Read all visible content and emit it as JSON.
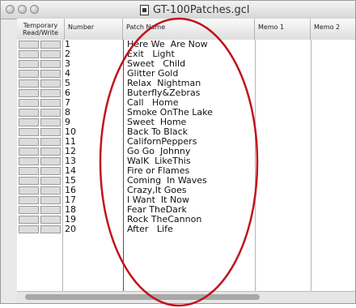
{
  "window": {
    "title": "GT-100Patches.gcl"
  },
  "columns": {
    "temporary": "Temporary",
    "read_write": "Read/Write",
    "number": "Number",
    "patch_name": "Patch Name",
    "memo1": "Memo 1",
    "memo2": "Memo 2"
  },
  "patches": [
    {
      "number": "1",
      "name": "Here We  Are Now"
    },
    {
      "number": "2",
      "name": "Exit   Light"
    },
    {
      "number": "3",
      "name": "Sweet   Child"
    },
    {
      "number": "4",
      "name": "Glitter Gold"
    },
    {
      "number": "5",
      "name": "Relax  Nightman"
    },
    {
      "number": "6",
      "name": "Buterfly&Zebras"
    },
    {
      "number": "7",
      "name": "Call   Home"
    },
    {
      "number": "8",
      "name": "Smoke OnThe Lake"
    },
    {
      "number": "9",
      "name": "Sweet  Home"
    },
    {
      "number": "10",
      "name": "Back To Black"
    },
    {
      "number": "11",
      "name": "CalifornPeppers"
    },
    {
      "number": "12",
      "name": "Go Go  Johnny"
    },
    {
      "number": "13",
      "name": "WalK  LikeThis"
    },
    {
      "number": "14",
      "name": "Fire or Flames"
    },
    {
      "number": "15",
      "name": "Coming  In Waves"
    },
    {
      "number": "16",
      "name": "Crazy,It Goes"
    },
    {
      "number": "17",
      "name": "I Want  It Now"
    },
    {
      "number": "18",
      "name": "Fear TheDark"
    },
    {
      "number": "19",
      "name": "Rock TheCannon"
    },
    {
      "number": "20",
      "name": "After   Life"
    }
  ],
  "colors": {
    "annotation": "#c0141c"
  },
  "icons": {
    "document": "document-icon"
  }
}
